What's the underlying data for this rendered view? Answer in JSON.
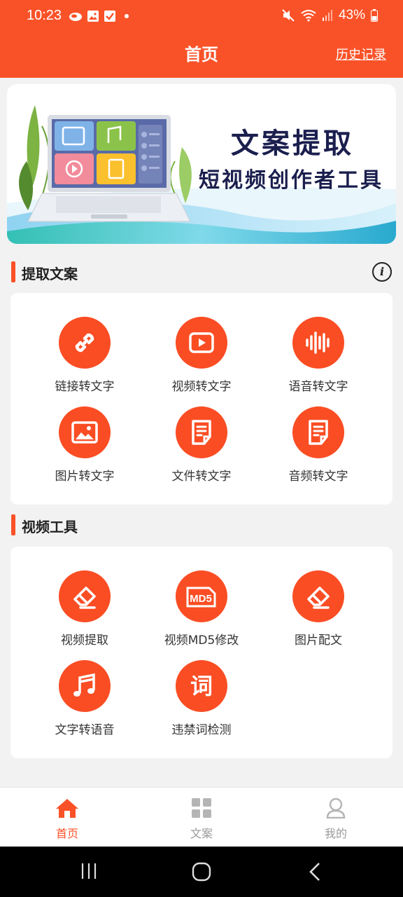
{
  "status": {
    "time": "10:23",
    "battery": "43%"
  },
  "header": {
    "title": "首页",
    "history_link": "历史记录"
  },
  "banner": {
    "title": "文案提取",
    "subtitle": "短视频创作者工具"
  },
  "section1": {
    "title": "提取文案",
    "tools": [
      {
        "label": "链接转文字",
        "icon": "link-icon"
      },
      {
        "label": "视频转文字",
        "icon": "video-play-icon"
      },
      {
        "label": "语音转文字",
        "icon": "sound-wave-icon"
      },
      {
        "label": "图片转文字",
        "icon": "image-icon"
      },
      {
        "label": "文件转文字",
        "icon": "document-icon"
      },
      {
        "label": "音频转文字",
        "icon": "document-icon"
      }
    ]
  },
  "section2": {
    "title": "视频工具",
    "tools": [
      {
        "label": "视频提取",
        "icon": "eraser-icon"
      },
      {
        "label": "视频MD5修改",
        "icon": "md5-icon"
      },
      {
        "label": "图片配文",
        "icon": "eraser-icon"
      },
      {
        "label": "文字转语音",
        "icon": "music-note-icon"
      },
      {
        "label": "违禁词检测",
        "icon": "word-icon"
      }
    ],
    "md5_glyph": "MD5",
    "word_glyph": "词"
  },
  "nav": {
    "items": [
      {
        "label": "首页",
        "icon": "home-icon"
      },
      {
        "label": "文案",
        "icon": "grid-icon"
      },
      {
        "label": "我的",
        "icon": "person-icon"
      }
    ],
    "active_color": "#fa5228",
    "inactive_color": "#9a9a9a"
  },
  "accent_color": "#fa5228"
}
